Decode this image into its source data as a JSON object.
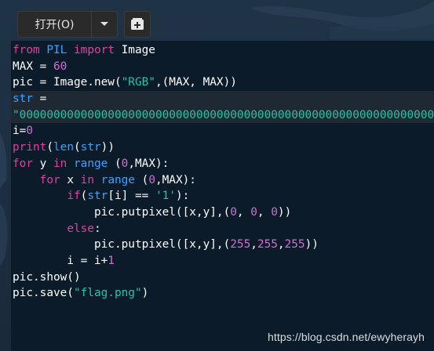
{
  "toolbar": {
    "open_label": "打开(O)",
    "dropdown_icon": "chevron-down-icon",
    "new_tab_icon": "new-tab-plus-icon"
  },
  "editor": {
    "lines": [
      [
        {
          "t": "from",
          "c": "kw"
        },
        {
          "t": " ",
          "c": "fn"
        },
        {
          "t": "PIL",
          "c": "bi"
        },
        {
          "t": " ",
          "c": "fn"
        },
        {
          "t": "import",
          "c": "kw"
        },
        {
          "t": " Image",
          "c": "fn"
        }
      ],
      [
        {
          "t": "MAX = ",
          "c": "fn"
        },
        {
          "t": "60",
          "c": "num"
        }
      ],
      [
        {
          "t": "pic = Image.new(",
          "c": "fn"
        },
        {
          "t": "\"RGB\"",
          "c": "str"
        },
        {
          "t": ",(MAX, MAX))",
          "c": "fn"
        }
      ],
      [
        {
          "t": "str",
          "c": "bi"
        },
        {
          "t": " =",
          "c": "fn"
        }
      ],
      [
        {
          "t": "\"00000000000000000000000000000000000000000000000000000000000000",
          "c": "str"
        }
      ],
      [
        {
          "t": "i=",
          "c": "fn"
        },
        {
          "t": "0",
          "c": "num"
        }
      ],
      [
        {
          "t": "print",
          "c": "kw"
        },
        {
          "t": "(",
          "c": "fn"
        },
        {
          "t": "len",
          "c": "bi"
        },
        {
          "t": "(",
          "c": "fn"
        },
        {
          "t": "str",
          "c": "bi"
        },
        {
          "t": "))",
          "c": "fn"
        }
      ],
      [
        {
          "t": "for",
          "c": "kw"
        },
        {
          "t": " y ",
          "c": "fn"
        },
        {
          "t": "in",
          "c": "kw"
        },
        {
          "t": " ",
          "c": "fn"
        },
        {
          "t": "range",
          "c": "bi"
        },
        {
          "t": " (",
          "c": "fn"
        },
        {
          "t": "0",
          "c": "num"
        },
        {
          "t": ",MAX):",
          "c": "fn"
        }
      ],
      [
        {
          "t": "    ",
          "c": "fn"
        },
        {
          "t": "for",
          "c": "kw"
        },
        {
          "t": " x ",
          "c": "fn"
        },
        {
          "t": "in",
          "c": "kw"
        },
        {
          "t": " ",
          "c": "fn"
        },
        {
          "t": "range",
          "c": "bi"
        },
        {
          "t": " (",
          "c": "fn"
        },
        {
          "t": "0",
          "c": "num"
        },
        {
          "t": ",MAX):",
          "c": "fn"
        }
      ],
      [
        {
          "t": "        ",
          "c": "fn"
        },
        {
          "t": "if",
          "c": "kw"
        },
        {
          "t": "(",
          "c": "fn"
        },
        {
          "t": "str",
          "c": "bi"
        },
        {
          "t": "[i] == ",
          "c": "fn"
        },
        {
          "t": "'1'",
          "c": "str"
        },
        {
          "t": "):",
          "c": "fn"
        }
      ],
      [
        {
          "t": "            pic.putpixel([x,y],(",
          "c": "fn"
        },
        {
          "t": "0",
          "c": "num"
        },
        {
          "t": ", ",
          "c": "fn"
        },
        {
          "t": "0",
          "c": "num"
        },
        {
          "t": ", ",
          "c": "fn"
        },
        {
          "t": "0",
          "c": "num"
        },
        {
          "t": "))",
          "c": "fn"
        }
      ],
      [
        {
          "t": "        ",
          "c": "fn"
        },
        {
          "t": "else",
          "c": "kw"
        },
        {
          "t": ":",
          "c": "fn"
        }
      ],
      [
        {
          "t": "            pic.putpixel([x,y],(",
          "c": "fn"
        },
        {
          "t": "255",
          "c": "num"
        },
        {
          "t": ",",
          "c": "fn"
        },
        {
          "t": "255",
          "c": "num"
        },
        {
          "t": ",",
          "c": "fn"
        },
        {
          "t": "255",
          "c": "num"
        },
        {
          "t": "))",
          "c": "fn"
        }
      ],
      [
        {
          "t": "        i = i+",
          "c": "fn"
        },
        {
          "t": "1",
          "c": "num"
        }
      ],
      [
        {
          "t": "pic.show()",
          "c": "fn"
        }
      ],
      [
        {
          "t": "pic.save(",
          "c": "fn"
        },
        {
          "t": "\"flag.png\"",
          "c": "str"
        },
        {
          "t": ")",
          "c": "fn"
        }
      ]
    ],
    "highlighted_lines": [
      3,
      4
    ]
  },
  "watermark": "https://blog.csdn.net/ewyherayh",
  "colors": {
    "keyword": "#e040a0",
    "builtin": "#3aa4ff",
    "number": "#d070d0",
    "string": "#21c7a8",
    "editor_bg": "#0b1b2a"
  }
}
